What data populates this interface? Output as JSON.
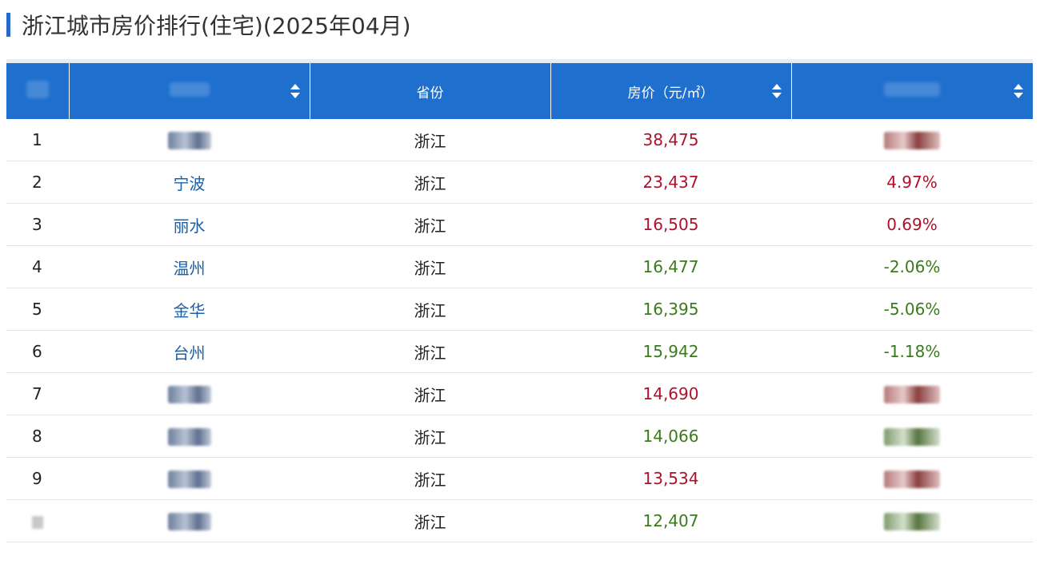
{
  "page": {
    "title": "浙江城市房价排行(住宅)(2025年04月)"
  },
  "colors": {
    "header_bg": "#1e6fce",
    "accent": "#2868c8",
    "city_link": "#1a5fa8",
    "price_up": "#b0102a",
    "price_down": "#3a7a1c"
  },
  "table": {
    "headers": {
      "province": "省份",
      "price": "房价（元/㎡）"
    },
    "rows": [
      {
        "rank": "1",
        "city": "",
        "province": "浙江",
        "price": "38,475",
        "change": "",
        "trend": "up"
      },
      {
        "rank": "2",
        "city": "宁波",
        "province": "浙江",
        "price": "23,437",
        "change": "4.97%",
        "trend": "up"
      },
      {
        "rank": "3",
        "city": "丽水",
        "province": "浙江",
        "price": "16,505",
        "change": "0.69%",
        "trend": "up"
      },
      {
        "rank": "4",
        "city": "温州",
        "province": "浙江",
        "price": "16,477",
        "change": "-2.06%",
        "trend": "down"
      },
      {
        "rank": "5",
        "city": "金华",
        "province": "浙江",
        "price": "16,395",
        "change": "-5.06%",
        "trend": "down"
      },
      {
        "rank": "6",
        "city": "台州",
        "province": "浙江",
        "price": "15,942",
        "change": "-1.18%",
        "trend": "down"
      },
      {
        "rank": "7",
        "city": "",
        "province": "浙江",
        "price": "14,690",
        "change": "",
        "trend": "up"
      },
      {
        "rank": "8",
        "city": "",
        "province": "浙江",
        "price": "14,066",
        "change": "",
        "trend": "down"
      },
      {
        "rank": "9",
        "city": "",
        "province": "浙江",
        "price": "13,534",
        "change": "",
        "trend": "up"
      },
      {
        "rank": "",
        "city": "",
        "province": "浙江",
        "price": "12,407",
        "change": "",
        "trend": "down"
      }
    ]
  }
}
